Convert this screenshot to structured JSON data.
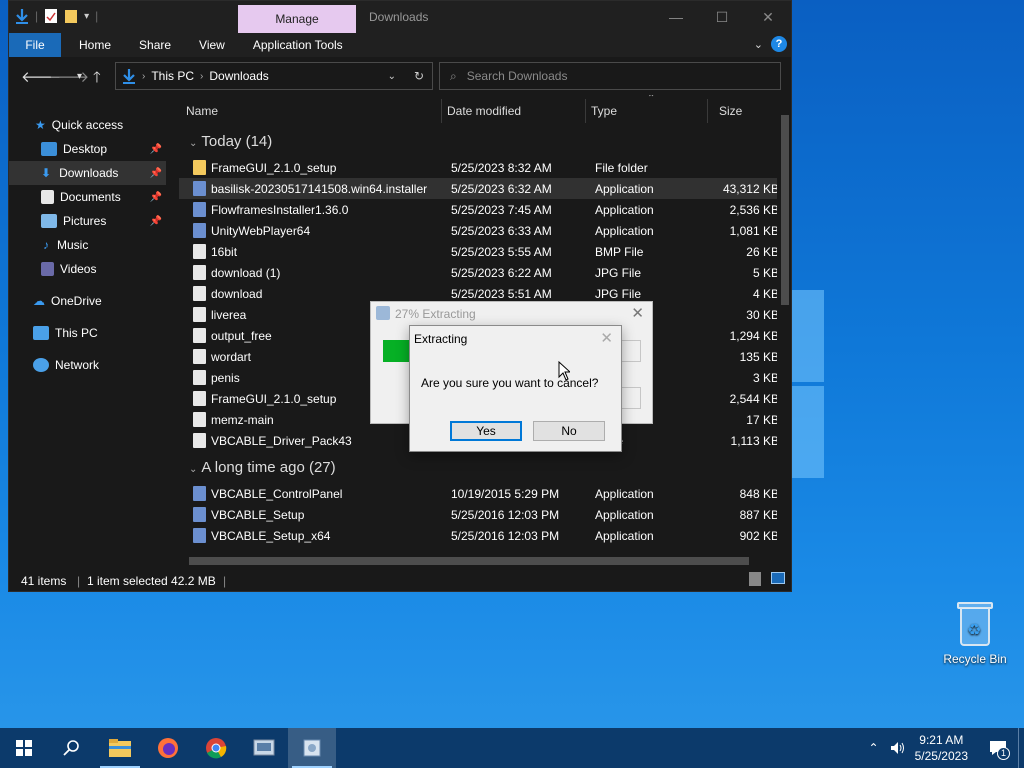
{
  "window": {
    "title": "Downloads",
    "manage_tab": "Manage",
    "minimize": "—",
    "maximize": "☐",
    "close": "✕"
  },
  "ribbon": {
    "tabs": [
      "File",
      "Home",
      "Share",
      "View",
      "Application Tools"
    ],
    "help": "?"
  },
  "address": {
    "crumbs": [
      "This PC",
      "Downloads"
    ],
    "search_placeholder": "Search Downloads"
  },
  "sidebar": {
    "items": [
      {
        "label": "Quick access"
      },
      {
        "label": "Desktop"
      },
      {
        "label": "Downloads"
      },
      {
        "label": "Documents"
      },
      {
        "label": "Pictures"
      },
      {
        "label": "Music"
      },
      {
        "label": "Videos"
      },
      {
        "label": "OneDrive"
      },
      {
        "label": "This PC"
      },
      {
        "label": "Network"
      }
    ]
  },
  "columns": [
    "Name",
    "Date modified",
    "Type",
    "Size"
  ],
  "groups": {
    "today": "Today (14)",
    "older": "A long time ago (27)"
  },
  "files": [
    {
      "name": "FrameGUI_2.1.0_setup",
      "date": "5/25/2023 8:32 AM",
      "type": "File folder",
      "size": ""
    },
    {
      "name": "basilisk-20230517141508.win64.installer",
      "date": "5/25/2023 6:32 AM",
      "type": "Application",
      "size": "43,312 KB"
    },
    {
      "name": "FlowframesInstaller1.36.0",
      "date": "5/25/2023 7:45 AM",
      "type": "Application",
      "size": "2,536 KB"
    },
    {
      "name": "UnityWebPlayer64",
      "date": "5/25/2023 6:33 AM",
      "type": "Application",
      "size": "1,081 KB"
    },
    {
      "name": "16bit",
      "date": "5/25/2023 5:55 AM",
      "type": "BMP File",
      "size": "26 KB"
    },
    {
      "name": "download (1)",
      "date": "5/25/2023 6:22 AM",
      "type": "JPG File",
      "size": "5 KB"
    },
    {
      "name": "download",
      "date": "5/25/2023 5:51 AM",
      "type": "JPG File",
      "size": "4 KB"
    },
    {
      "name": "liverea",
      "date": "",
      "type": "",
      "size": "30 KB"
    },
    {
      "name": "output_free",
      "date": "",
      "type": "",
      "size": "1,294 KB"
    },
    {
      "name": "wordart",
      "date": "",
      "type": "",
      "size": "135 KB"
    },
    {
      "name": "penis",
      "date": "",
      "type": "tificate",
      "size": "3 KB"
    },
    {
      "name": "FrameGUI_2.1.0_setup",
      "date": "",
      "type": "",
      "size": "2,544 KB"
    },
    {
      "name": "memz-main",
      "date": "",
      "type": "",
      "size": "17 KB"
    },
    {
      "name": "VBCABLE_Driver_Pack43",
      "date": "",
      "type": "chive",
      "size": "1,113 KB"
    }
  ],
  "older_files": [
    {
      "name": "VBCABLE_ControlPanel",
      "date": "10/19/2015 5:29 PM",
      "type": "Application",
      "size": "848 KB"
    },
    {
      "name": "VBCABLE_Setup",
      "date": "5/25/2016 12:03 PM",
      "type": "Application",
      "size": "887 KB"
    },
    {
      "name": "VBCABLE_Setup_x64",
      "date": "5/25/2016 12:03 PM",
      "type": "Application",
      "size": "902 KB"
    }
  ],
  "status": {
    "count": "41 items",
    "selected": "1 item selected  42.2 MB"
  },
  "progress": {
    "title": "27% Extracting",
    "percent": 27
  },
  "dialog": {
    "title": "Extracting",
    "message": "Are you sure you want to cancel?",
    "yes": "Yes",
    "no": "No"
  },
  "desktop": {
    "recycle_bin": "Recycle Bin"
  },
  "clock": {
    "time": "9:21 AM",
    "date": "5/25/2023",
    "notifications": "1"
  },
  "colors": {
    "accent": "#1a6ab8",
    "manage": "#e6c9ef",
    "progress": "#06b025"
  }
}
